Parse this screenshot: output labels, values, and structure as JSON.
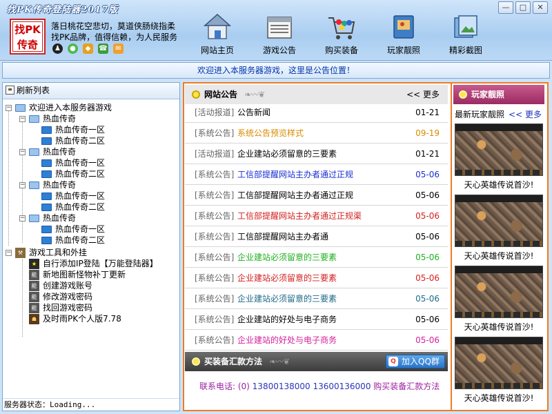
{
  "window": {
    "title": "找PK传奇登陆器2017版",
    "buttons": {
      "min": "—",
      "max": "□",
      "close": "✕"
    }
  },
  "header": {
    "logo_line1": "找PK",
    "logo_line2": "传奇",
    "slogan_line1": "落日桃花空悲切，莫道侠肠绕指柔",
    "slogan_line2": "找PK品牌，值得信赖，为人民服务",
    "social_icons": [
      "qq-icon",
      "wechat-icon",
      "tiger-icon",
      "phone-icon",
      "mail-icon"
    ]
  },
  "nav": [
    {
      "label": "网站主页",
      "icon": "house-icon"
    },
    {
      "label": "游戏公告",
      "icon": "newspaper-icon"
    },
    {
      "label": "购买装备",
      "icon": "shopping-cart-icon"
    },
    {
      "label": "玩家靓照",
      "icon": "photo-album-icon"
    },
    {
      "label": "精彩截图",
      "icon": "screenshot-icon"
    }
  ],
  "notice": "欢迎进入本服务器游戏，这里是公告位置！",
  "tree": {
    "refresh_label": "刷新列表",
    "root": "欢迎进入本服务器游戏",
    "groups": [
      {
        "name": "热血传奇",
        "servers": [
          "热血传奇一区",
          "热血传奇二区"
        ]
      },
      {
        "name": "热血传奇",
        "servers": [
          "热血传奇一区",
          "热血传奇二区"
        ]
      },
      {
        "name": "热血传奇",
        "servers": [
          "热血传奇一区",
          "热血传奇二区"
        ]
      },
      {
        "name": "热血传奇",
        "servers": [
          "热血传奇一区",
          "热血传奇二区"
        ]
      }
    ],
    "tools_root": "游戏工具和外挂",
    "tools": [
      "自行添加IP登陆【万能登陆器】",
      "新地图新怪物补丁更新",
      "创建游戏账号",
      "修改游戏密码",
      "找回游戏密码",
      "及时雨PK个人版7.78"
    ],
    "status": "服务器状态：Loading..."
  },
  "news": {
    "title": "网站公告",
    "more": "<< 更多",
    "items": [
      {
        "cat": "[活动报道]",
        "title": "公告新闻",
        "date": "01-21",
        "color": "#000000"
      },
      {
        "cat": "[系统公告]",
        "title": "系统公告预览样式",
        "date": "09-19",
        "color": "#d98a00"
      },
      {
        "cat": "[活动报道]",
        "title": "企业建站必须留意的三要素",
        "date": "01-21",
        "color": "#000000"
      },
      {
        "cat": "[系统公告]",
        "title": "工信部提醒网站主办者通过正规",
        "date": "05-06",
        "color": "#1a2fcf"
      },
      {
        "cat": "[系统公告]",
        "title": "工信部提醒网站主办者通过正规",
        "date": "05-06",
        "color": "#000000"
      },
      {
        "cat": "[系统公告]",
        "title": "工信部提醒网站主办者通过正规渠",
        "date": "05-06",
        "color": "#d42020"
      },
      {
        "cat": "[系统公告]",
        "title": "工信部提醒网站主办者通",
        "date": "05-06",
        "color": "#000000"
      },
      {
        "cat": "[系统公告]",
        "title": "企业建站必须留意的三要素",
        "date": "05-06",
        "color": "#1fb01f"
      },
      {
        "cat": "[系统公告]",
        "title": "企业建站必须留意的三要素",
        "date": "05-06",
        "color": "#d42020"
      },
      {
        "cat": "[系统公告]",
        "title": "企业建站必须留意的三要素",
        "date": "05-06",
        "color": "#1f6a8a"
      },
      {
        "cat": "[系统公告]",
        "title": "企业建站的好处与电子商务",
        "date": "05-06",
        "color": "#000000"
      },
      {
        "cat": "[系统公告]",
        "title": "企业建站的好处与电子商务",
        "date": "05-06",
        "color": "#d4219b"
      }
    ]
  },
  "payment": {
    "title": "买装备汇款方法",
    "qq_button": "加入QQ群",
    "phone_label": "联系电话: (0) ",
    "phone_numbers": "13800138000 13600136000",
    "phone_suffix": " 购买装备汇款方法"
  },
  "photos": {
    "title": "玩家靓照",
    "subtitle": "最新玩家靓照",
    "more": "<< 更多",
    "captions": [
      "天心英雄传说首沙!",
      "天心英雄传说首沙!",
      "天心英雄传说首沙!",
      "天心英雄传说首沙!"
    ]
  }
}
